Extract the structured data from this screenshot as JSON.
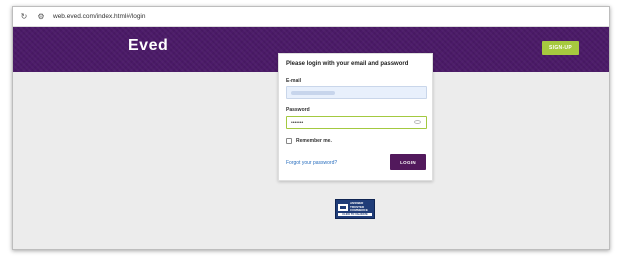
{
  "browser": {
    "url": "web.eved.com/index.html#/login",
    "reload_icon": "reload-icon",
    "site_settings_icon": "tune-icon"
  },
  "header": {
    "logo_text": "Eved",
    "signup_label": "SIGN-UP",
    "colors": {
      "band": "#4b1a68",
      "signup": "#a6c93f"
    }
  },
  "login": {
    "title": "Please login with your email and password",
    "email_label": "E-mail",
    "email_value": "",
    "password_label": "Password",
    "password_value": "•••••••",
    "remember_label": "Remember me.",
    "forgot_label": "Forgot your password?",
    "login_label": "LOGIN",
    "colors": {
      "login_button": "#52195c",
      "password_focus": "#a3c940",
      "link": "#2a6fbf"
    }
  },
  "badge": {
    "line1": "ANSWER",
    "line2": "TRUSTED",
    "line3": "COMMERCE",
    "bottom": "CLICK TO VALIDATE"
  }
}
